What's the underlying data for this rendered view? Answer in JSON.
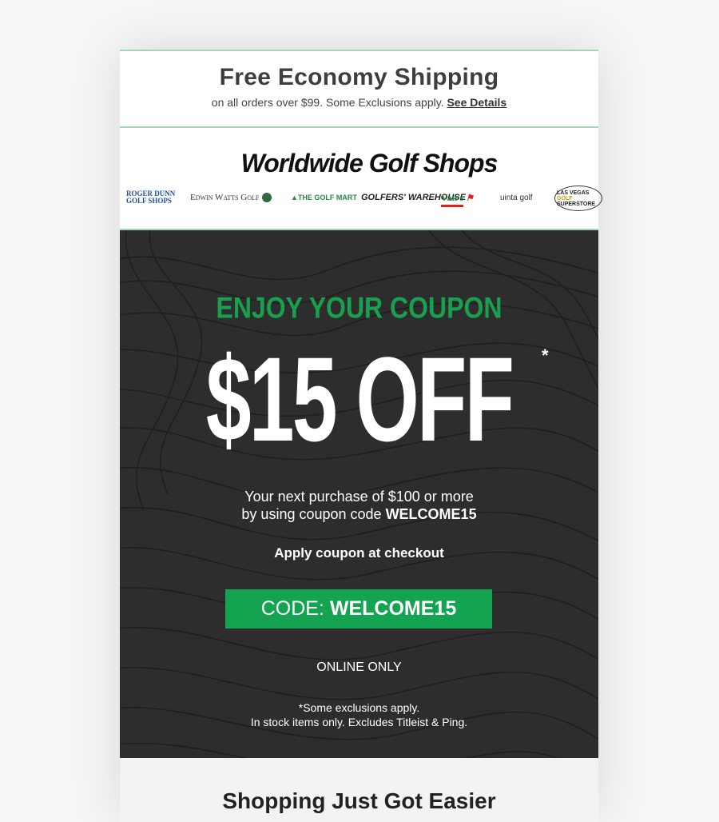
{
  "shipping": {
    "title": "Free Economy Shipping",
    "subtitle": "on all orders over $99. Some Exclusions apply.",
    "link": "See Details"
  },
  "brand": {
    "name": "Worldwide Golf Shops",
    "logos": {
      "roger_1": "ROGER DUNN",
      "roger_2": "GOLF SHOPS",
      "edwin": "Edwin Watts Golf",
      "mart": "THE GOLF MART",
      "gw_1": "GOLFERS'",
      "gw_2": "WAREHOUSE",
      "vans": "Van's",
      "uinta": "uinta golf",
      "lv_1": "LAS VEGAS",
      "lv_2": "GOLF",
      "lv_3": "SUPERSTORE"
    }
  },
  "promo": {
    "eyebrow": "ENJOY  YOUR COUPON",
    "headline": "$15 OFF",
    "asterisk": "*",
    "desc_line1": "Your next purchase of $100 or more",
    "desc_line2_prefix": "by using coupon code ",
    "desc_code": "WELCOME15",
    "apply": "Apply coupon at checkout",
    "code_label": "CODE: ",
    "code_value": "WELCOME15",
    "online": "ONLINE ONLY",
    "fine_1": "*Some exclusions apply.",
    "fine_2": "In stock items only. Excludes Titleist & Ping."
  },
  "below": {
    "title": "Shopping Just Got Easier"
  },
  "colors": {
    "accent_green": "#14a350",
    "promo_bg": "#2d2d2d"
  }
}
